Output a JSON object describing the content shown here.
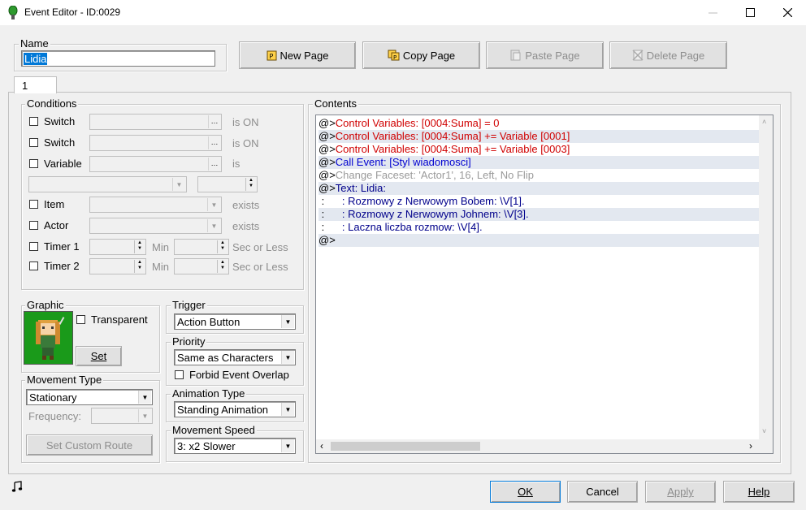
{
  "window": {
    "title": "Event Editor - ID:0029"
  },
  "name_group": {
    "label": "Name",
    "value": "Lidia"
  },
  "page_buttons": {
    "new": "New Page",
    "copy": "Copy Page",
    "paste": "Paste Page",
    "delete": "Delete Page"
  },
  "page_tab": "1",
  "conditions": {
    "label": "Conditions",
    "switch1": {
      "label": "Switch",
      "suffix": "is ON"
    },
    "switch2": {
      "label": "Switch",
      "suffix": "is ON"
    },
    "variable": {
      "label": "Variable",
      "suffix": "is"
    },
    "item": {
      "label": "Item",
      "suffix": "exists"
    },
    "actor": {
      "label": "Actor",
      "suffix": "exists"
    },
    "timer1": {
      "label": "Timer 1",
      "min": "Min",
      "sec": "Sec or Less"
    },
    "timer2": {
      "label": "Timer 2",
      "min": "Min",
      "sec": "Sec or Less"
    }
  },
  "graphic": {
    "label": "Graphic",
    "transparent": "Transparent",
    "set": "Set"
  },
  "trigger": {
    "label": "Trigger",
    "value": "Action Button"
  },
  "priority": {
    "label": "Priority",
    "value": "Same as Characters",
    "forbid": "Forbid Event Overlap"
  },
  "movement_type": {
    "label": "Movement Type",
    "value": "Stationary",
    "frequency": "Frequency:",
    "route": "Set Custom Route"
  },
  "animation_type": {
    "label": "Animation Type",
    "value": "Standing Animation"
  },
  "movement_speed": {
    "label": "Movement Speed",
    "value": "3: x2 Slower"
  },
  "contents": {
    "label": "Contents",
    "lines": [
      {
        "prefix": "@>",
        "text": "Control Variables: [0004:Suma] = 0",
        "color": "#d00000"
      },
      {
        "prefix": "@>",
        "text": "Control Variables: [0004:Suma] += Variable [0001]",
        "color": "#d00000"
      },
      {
        "prefix": "@>",
        "text": "Control Variables: [0004:Suma] += Variable [0003]",
        "color": "#d00000"
      },
      {
        "prefix": "@>",
        "text": "Call Event: [Styl wiadomosci]",
        "color": "#0000d0"
      },
      {
        "prefix": "@>",
        "text": "Change Faceset: 'Actor1', 16, Left, No Flip",
        "color": "#9a9a9a"
      },
      {
        "prefix": "@>",
        "text": "Text: Lidia:",
        "color": "#00008b"
      },
      {
        "prefix": " :",
        "text": "      : Rozmowy z Nerwowym Bobem: \\V[1].",
        "color": "#00008b"
      },
      {
        "prefix": " :",
        "text": "      : Rozmowy z Nerwowym Johnem: \\V[3].",
        "color": "#00008b"
      },
      {
        "prefix": " :",
        "text": "      : Laczna liczba rozmow: \\V[4].",
        "color": "#00008b"
      },
      {
        "prefix": "@>",
        "text": "",
        "color": "#000000"
      }
    ]
  },
  "footer": {
    "ok": "OK",
    "cancel": "Cancel",
    "apply": "Apply",
    "help": "Help"
  }
}
